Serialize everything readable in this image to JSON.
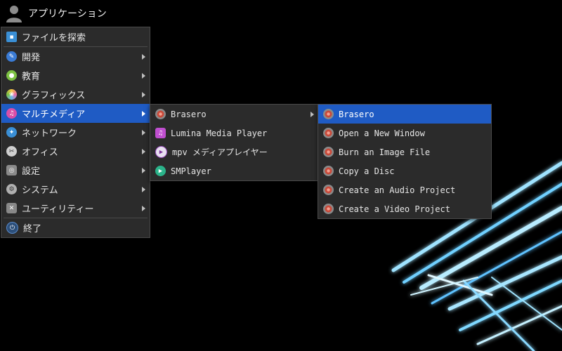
{
  "panel": {
    "title": "アプリケーション",
    "icon": "user-icon"
  },
  "main_menu": {
    "search": {
      "label": "ファイルを探索",
      "icon": "folder-icon"
    },
    "categories": [
      {
        "label": "開発",
        "icon": "wrench-icon",
        "color": "#3a7bd5"
      },
      {
        "label": "教育",
        "icon": "education-icon",
        "color": "#7cc142"
      },
      {
        "label": "グラフィックス",
        "icon": "graphics-icon",
        "color": "#e96ba8"
      },
      {
        "label": "マルチメディア",
        "icon": "music-icon",
        "color": "#d94fa8",
        "active": true
      },
      {
        "label": "ネットワーク",
        "icon": "network-icon",
        "color": "#3a8fd5"
      },
      {
        "label": "オフィス",
        "icon": "paperclip-icon",
        "color": "#9a9a9a"
      },
      {
        "label": "設定",
        "icon": "settings-icon",
        "color": "#8a8a8a"
      },
      {
        "label": "システム",
        "icon": "gear-icon",
        "color": "#b0b0b0"
      },
      {
        "label": "ユーティリティー",
        "icon": "tools-icon",
        "color": "#888888"
      }
    ],
    "quit": {
      "label": "終了",
      "icon": "power-icon"
    }
  },
  "multimedia_menu": {
    "items": [
      {
        "label": "Brasero",
        "icon": "brasero-icon"
      },
      {
        "label": "Lumina Media Player",
        "icon": "music-note-icon"
      },
      {
        "label": "mpv メディアプレイヤー",
        "icon": "mpv-icon"
      },
      {
        "label": "SMPlayer",
        "icon": "smplayer-icon"
      }
    ]
  },
  "brasero_menu": {
    "items": [
      {
        "label": "Brasero"
      },
      {
        "label": "Open a New Window"
      },
      {
        "label": "Burn an Image File"
      },
      {
        "label": "Copy a Disc"
      },
      {
        "label": "Create an Audio Project"
      },
      {
        "label": "Create a Video Project"
      }
    ]
  },
  "colors": {
    "highlight": "#1f5bc4",
    "menu_bg": "#2b2b2b",
    "glow": "#7fd8ff"
  }
}
